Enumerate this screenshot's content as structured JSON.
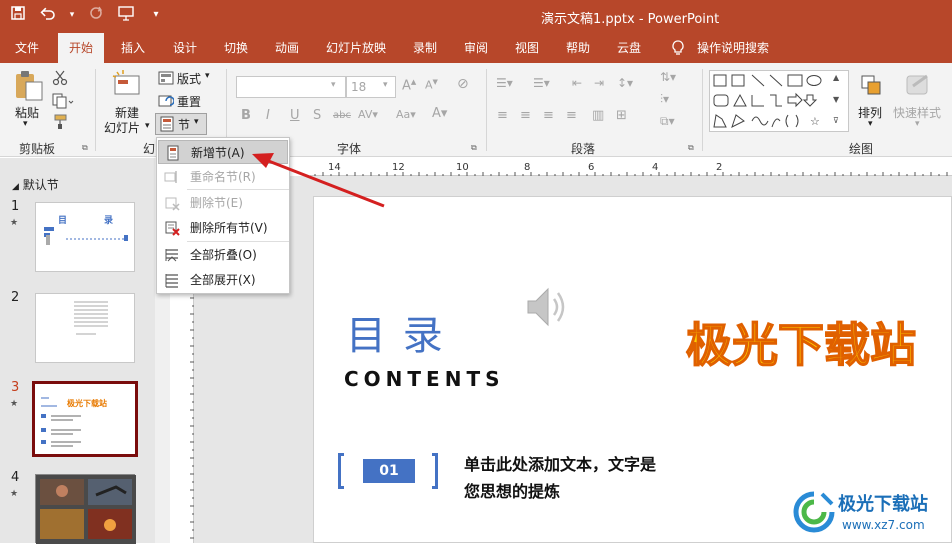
{
  "window": {
    "title": "演示文稿1.pptx  -  PowerPoint"
  },
  "tabs": [
    "文件",
    "开始",
    "插入",
    "设计",
    "切换",
    "动画",
    "幻灯片放映",
    "录制",
    "审阅",
    "视图",
    "帮助",
    "云盘",
    "操作说明搜索"
  ],
  "ribbon": {
    "clipboard": {
      "paste": "粘贴",
      "label": "剪贴板"
    },
    "slides": {
      "new_slide_line1": "新建",
      "new_slide_line2": "幻灯片",
      "layout": "版式",
      "reset": "重置",
      "section": "节",
      "label_partial": "幻"
    },
    "font": {
      "size": "18",
      "bold": "B",
      "italic": "I",
      "underline": "U",
      "strike": "S",
      "shadow": "abc",
      "label": "字体"
    },
    "paragraph": {
      "label": "段落"
    },
    "drawing": {
      "arrange": "排列",
      "quick_styles": "快速样式",
      "label": "绘图"
    }
  },
  "section_menu": {
    "items": [
      {
        "label": "新增节(A)",
        "enabled": true
      },
      {
        "label": "重命名节(R)",
        "enabled": false
      },
      {
        "label": "删除节(E)",
        "enabled": false
      },
      {
        "label": "删除所有节(V)",
        "enabled": true
      },
      {
        "label": "全部折叠(O)",
        "enabled": true
      },
      {
        "label": "全部展开(X)",
        "enabled": true
      }
    ]
  },
  "slides_panel": {
    "section_name": "默认节",
    "slides": [
      {
        "num": "1",
        "starred": true
      },
      {
        "num": "2",
        "starred": false
      },
      {
        "num": "3",
        "starred": true,
        "selected": true
      },
      {
        "num": "4",
        "starred": true
      }
    ],
    "slide1_title_a": "目",
    "slide1_title_b": "录",
    "slide3_title": "极光下载站"
  },
  "ruler_labels": [
    "14",
    "12",
    "10",
    "8",
    "6",
    "4",
    "2"
  ],
  "slide": {
    "title": "目 录",
    "subtitle": "CONTENTS",
    "watermark": "极光下载站",
    "item_num": "01",
    "item_text_line1": "单击此处添加文本，文字是",
    "item_text_line2": "您思想的提炼"
  },
  "brand_watermark": {
    "name": "极光下载站",
    "url": "www.xz7.com"
  },
  "colors": {
    "titlebar": "#b7472a",
    "accent_blue": "#4472c4",
    "watermark_orange": "#f5b800",
    "arrow_red": "#d42020"
  }
}
